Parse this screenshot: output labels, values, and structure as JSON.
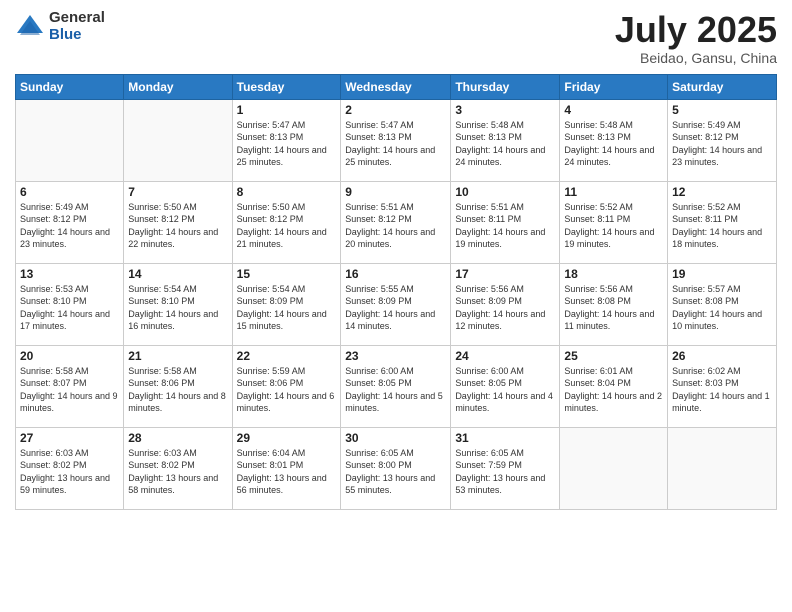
{
  "header": {
    "logo_general": "General",
    "logo_blue": "Blue",
    "title": "July 2025",
    "location": "Beidao, Gansu, China"
  },
  "days_of_week": [
    "Sunday",
    "Monday",
    "Tuesday",
    "Wednesday",
    "Thursday",
    "Friday",
    "Saturday"
  ],
  "weeks": [
    [
      {
        "day": "",
        "content": ""
      },
      {
        "day": "",
        "content": ""
      },
      {
        "day": "1",
        "content": "Sunrise: 5:47 AM\nSunset: 8:13 PM\nDaylight: 14 hours\nand 25 minutes."
      },
      {
        "day": "2",
        "content": "Sunrise: 5:47 AM\nSunset: 8:13 PM\nDaylight: 14 hours\nand 25 minutes."
      },
      {
        "day": "3",
        "content": "Sunrise: 5:48 AM\nSunset: 8:13 PM\nDaylight: 14 hours\nand 24 minutes."
      },
      {
        "day": "4",
        "content": "Sunrise: 5:48 AM\nSunset: 8:13 PM\nDaylight: 14 hours\nand 24 minutes."
      },
      {
        "day": "5",
        "content": "Sunrise: 5:49 AM\nSunset: 8:12 PM\nDaylight: 14 hours\nand 23 minutes."
      }
    ],
    [
      {
        "day": "6",
        "content": "Sunrise: 5:49 AM\nSunset: 8:12 PM\nDaylight: 14 hours\nand 23 minutes."
      },
      {
        "day": "7",
        "content": "Sunrise: 5:50 AM\nSunset: 8:12 PM\nDaylight: 14 hours\nand 22 minutes."
      },
      {
        "day": "8",
        "content": "Sunrise: 5:50 AM\nSunset: 8:12 PM\nDaylight: 14 hours\nand 21 minutes."
      },
      {
        "day": "9",
        "content": "Sunrise: 5:51 AM\nSunset: 8:12 PM\nDaylight: 14 hours\nand 20 minutes."
      },
      {
        "day": "10",
        "content": "Sunrise: 5:51 AM\nSunset: 8:11 PM\nDaylight: 14 hours\nand 19 minutes."
      },
      {
        "day": "11",
        "content": "Sunrise: 5:52 AM\nSunset: 8:11 PM\nDaylight: 14 hours\nand 19 minutes."
      },
      {
        "day": "12",
        "content": "Sunrise: 5:52 AM\nSunset: 8:11 PM\nDaylight: 14 hours\nand 18 minutes."
      }
    ],
    [
      {
        "day": "13",
        "content": "Sunrise: 5:53 AM\nSunset: 8:10 PM\nDaylight: 14 hours\nand 17 minutes."
      },
      {
        "day": "14",
        "content": "Sunrise: 5:54 AM\nSunset: 8:10 PM\nDaylight: 14 hours\nand 16 minutes."
      },
      {
        "day": "15",
        "content": "Sunrise: 5:54 AM\nSunset: 8:09 PM\nDaylight: 14 hours\nand 15 minutes."
      },
      {
        "day": "16",
        "content": "Sunrise: 5:55 AM\nSunset: 8:09 PM\nDaylight: 14 hours\nand 14 minutes."
      },
      {
        "day": "17",
        "content": "Sunrise: 5:56 AM\nSunset: 8:09 PM\nDaylight: 14 hours\nand 12 minutes."
      },
      {
        "day": "18",
        "content": "Sunrise: 5:56 AM\nSunset: 8:08 PM\nDaylight: 14 hours\nand 11 minutes."
      },
      {
        "day": "19",
        "content": "Sunrise: 5:57 AM\nSunset: 8:08 PM\nDaylight: 14 hours\nand 10 minutes."
      }
    ],
    [
      {
        "day": "20",
        "content": "Sunrise: 5:58 AM\nSunset: 8:07 PM\nDaylight: 14 hours\nand 9 minutes."
      },
      {
        "day": "21",
        "content": "Sunrise: 5:58 AM\nSunset: 8:06 PM\nDaylight: 14 hours\nand 8 minutes."
      },
      {
        "day": "22",
        "content": "Sunrise: 5:59 AM\nSunset: 8:06 PM\nDaylight: 14 hours\nand 6 minutes."
      },
      {
        "day": "23",
        "content": "Sunrise: 6:00 AM\nSunset: 8:05 PM\nDaylight: 14 hours\nand 5 minutes."
      },
      {
        "day": "24",
        "content": "Sunrise: 6:00 AM\nSunset: 8:05 PM\nDaylight: 14 hours\nand 4 minutes."
      },
      {
        "day": "25",
        "content": "Sunrise: 6:01 AM\nSunset: 8:04 PM\nDaylight: 14 hours\nand 2 minutes."
      },
      {
        "day": "26",
        "content": "Sunrise: 6:02 AM\nSunset: 8:03 PM\nDaylight: 14 hours\nand 1 minute."
      }
    ],
    [
      {
        "day": "27",
        "content": "Sunrise: 6:03 AM\nSunset: 8:02 PM\nDaylight: 13 hours\nand 59 minutes."
      },
      {
        "day": "28",
        "content": "Sunrise: 6:03 AM\nSunset: 8:02 PM\nDaylight: 13 hours\nand 58 minutes."
      },
      {
        "day": "29",
        "content": "Sunrise: 6:04 AM\nSunset: 8:01 PM\nDaylight: 13 hours\nand 56 minutes."
      },
      {
        "day": "30",
        "content": "Sunrise: 6:05 AM\nSunset: 8:00 PM\nDaylight: 13 hours\nand 55 minutes."
      },
      {
        "day": "31",
        "content": "Sunrise: 6:05 AM\nSunset: 7:59 PM\nDaylight: 13 hours\nand 53 minutes."
      },
      {
        "day": "",
        "content": ""
      },
      {
        "day": "",
        "content": ""
      }
    ]
  ]
}
